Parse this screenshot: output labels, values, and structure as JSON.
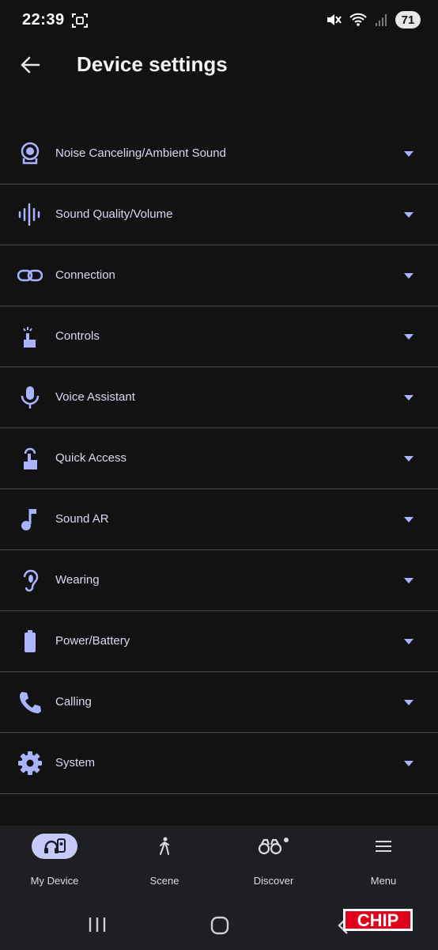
{
  "status": {
    "time": "22:39",
    "battery": "71"
  },
  "header": {
    "title": "Device settings"
  },
  "settings": [
    {
      "label": "Noise Canceling/Ambient Sound",
      "icon": "noise-canceling-icon"
    },
    {
      "label": "Sound Quality/Volume",
      "icon": "sound-wave-icon"
    },
    {
      "label": "Connection",
      "icon": "link-icon"
    },
    {
      "label": "Controls",
      "icon": "touch-icon"
    },
    {
      "label": "Voice Assistant",
      "icon": "microphone-icon"
    },
    {
      "label": "Quick Access",
      "icon": "tap-icon"
    },
    {
      "label": "Sound AR",
      "icon": "music-note-icon"
    },
    {
      "label": "Wearing",
      "icon": "ear-icon"
    },
    {
      "label": "Power/Battery",
      "icon": "battery-icon"
    },
    {
      "label": "Calling",
      "icon": "phone-icon"
    },
    {
      "label": "System",
      "icon": "gear-icon"
    }
  ],
  "nav": [
    {
      "label": "My Device",
      "icon": "headphones-device-icon",
      "active": true
    },
    {
      "label": "Scene",
      "icon": "walking-person-icon"
    },
    {
      "label": "Discover",
      "icon": "binoculars-icon"
    },
    {
      "label": "Menu",
      "icon": "hamburger-icon"
    }
  ],
  "watermark": "CHIP",
  "colors": {
    "accent": "#aab3ff",
    "background": "#121212",
    "active_pill": "#c5caf7"
  }
}
